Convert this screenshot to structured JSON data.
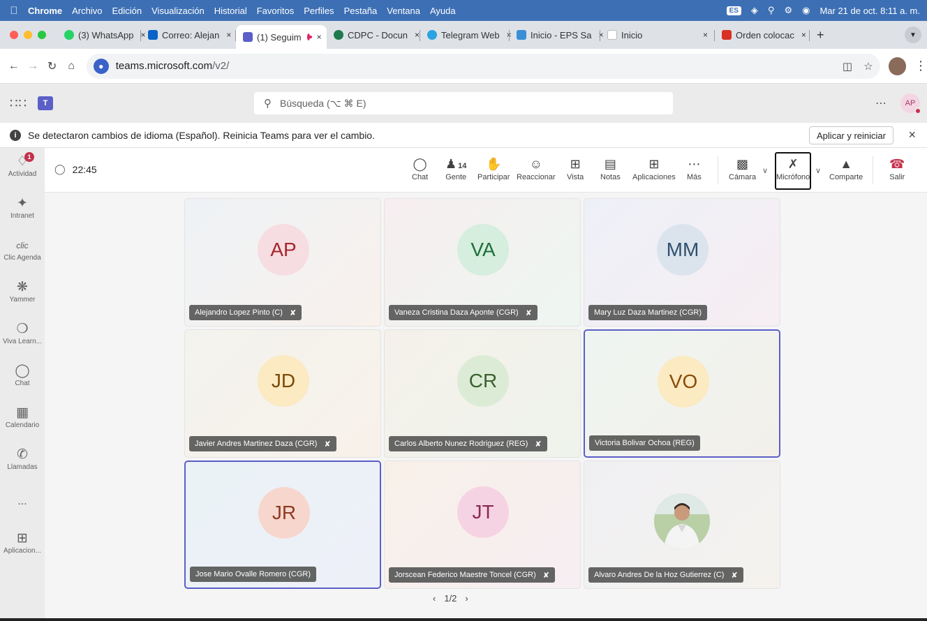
{
  "menubar": {
    "apple": "",
    "items": [
      "Chrome",
      "Archivo",
      "Edición",
      "Visualización",
      "Historial",
      "Favoritos",
      "Perfiles",
      "Pestaña",
      "Ventana",
      "Ayuda"
    ],
    "datetime": "Mar 21 de oct.  8:11 a. m."
  },
  "tabs": [
    {
      "label": "(3) WhatsApp",
      "color": "#25d366"
    },
    {
      "label": "Correo: Alejan",
      "color": "#0a64c8"
    },
    {
      "label": "(1) Seguim",
      "color": "#5b5fc7"
    },
    {
      "label": "CDPC - Docun",
      "color": "#1f7a4d"
    },
    {
      "label": "Telegram Web",
      "color": "#2aa3e0"
    },
    {
      "label": "Inicio - EPS Sa",
      "color": "#3a8fd6"
    },
    {
      "label": "Inicio",
      "color": "#ffffff"
    },
    {
      "label": "Orden colocac",
      "color": "#d93025"
    }
  ],
  "address": {
    "host": "teams.microsoft.com",
    "path": "/v2/"
  },
  "teams": {
    "search_placeholder": "Búsqueda (⌥ ⌘ E)",
    "me_initials": "AP"
  },
  "notice": {
    "text": "Se detectaron cambios de idioma (Español). Reinicia Teams para ver el cambio.",
    "apply_label": "Aplicar y reiniciar"
  },
  "rail": {
    "activity": {
      "label": "Actividad",
      "badge": "1"
    },
    "intranet": "Intranet",
    "clic_agenda": "Clic Agenda",
    "yammer": "Yammer",
    "viva": "Viva Learn...",
    "chat": "Chat",
    "calendar": "Calendario",
    "calls": "Llamadas",
    "more": "...",
    "apps": "Aplicacion..."
  },
  "meeting": {
    "timer": "22:45",
    "chat": "Chat",
    "people": "Gente",
    "people_count": "14",
    "raise": "Participar",
    "react": "Reaccionar",
    "view": "Vista",
    "notes": "Notas",
    "apps": "Aplicaciones",
    "more": "Más",
    "camera": "Cámara",
    "mic": "Micrófono",
    "share": "Comparte",
    "leave": "Salir"
  },
  "participants": [
    {
      "initials": "AP",
      "name": "Alejandro Lopez Pinto (C)",
      "muted": true,
      "bg": "#f6dde2",
      "fg": "#a4262c",
      "active": false
    },
    {
      "initials": "VA",
      "name": "Vaneza Cristina Daza Aponte (CGR)",
      "muted": true,
      "bg": "#d5eedd",
      "fg": "#1e6e3a",
      "active": false
    },
    {
      "initials": "MM",
      "name": "Mary Luz Daza Martinez (CGR)",
      "muted": false,
      "bg": "#dbe4ec",
      "fg": "#2f4f6e",
      "active": false
    },
    {
      "initials": "JD",
      "name": "Javier Andres Martinez Daza (CGR)",
      "muted": true,
      "bg": "#fbeac2",
      "fg": "#7a4a0a",
      "active": false
    },
    {
      "initials": "CR",
      "name": "Carlos Alberto Nunez Rodriguez (REG)",
      "muted": true,
      "bg": "#dcebd6",
      "fg": "#3b5f2e",
      "active": false
    },
    {
      "initials": "VO",
      "name": "Victoria Bolivar Ochoa (REG)",
      "muted": false,
      "bg": "#fbeac2",
      "fg": "#8a4b08",
      "active": true
    },
    {
      "initials": "JR",
      "name": "Jose Mario Ovalle Romero (CGR)",
      "muted": false,
      "bg": "#f7d7cd",
      "fg": "#8e3a22",
      "active": true
    },
    {
      "initials": "JT",
      "name": "Jorscean Federico Maestre Toncel (CGR)",
      "muted": true,
      "bg": "#f6d3e2",
      "fg": "#8a2a55",
      "active": false
    },
    {
      "initials": "",
      "name": "Alvaro Andres De la Hoz Gutierrez (C)",
      "muted": true,
      "bg": "#c9d7b8",
      "fg": "#333333",
      "active": false
    }
  ],
  "pager": {
    "prev": "‹",
    "label": "1/2",
    "next": "›"
  }
}
